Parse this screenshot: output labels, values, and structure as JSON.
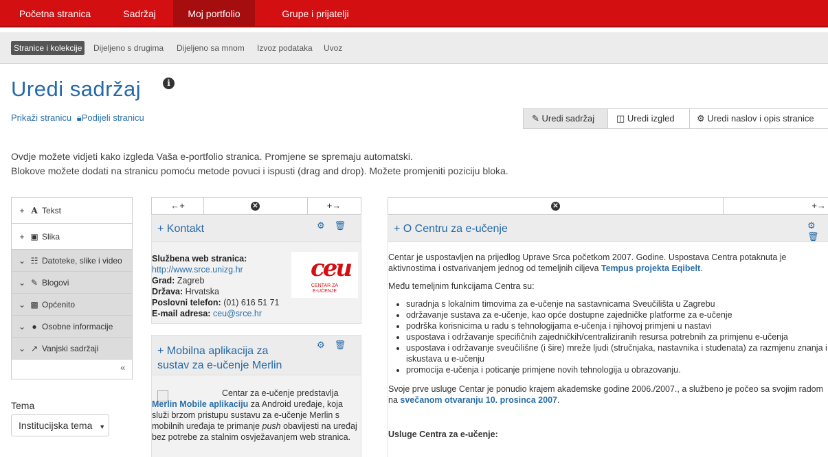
{
  "topnav": [
    "Početna stranica",
    "Sadržaj",
    "Moj portfolio",
    "Grupe i prijatelji"
  ],
  "subnav": [
    "Stranice i kolekcije",
    "Dijeljeno s drugima",
    "Dijeljeno sa mnom",
    "Izvoz podataka",
    "Uvoz"
  ],
  "page": {
    "title": "Uredi sadržaj",
    "info_icon": "i",
    "view_link": "Prikaži stranicu",
    "share_link": "Podijeli stranicu"
  },
  "edit_buttons": [
    "Uredi sadržaj",
    "Uredi izgled",
    "Uredi naslov i opis stranice"
  ],
  "intro": [
    "Ovdje možete vidjeti kako izgleda Vaša e-portfolio stranica. Promjene se spremaju automatski.",
    "Blokove možete dodati na stranicu pomoću metode povuci i ispusti (drag and drop). Možete promjeniti poziciju bloka."
  ],
  "sidebar": {
    "items": [
      {
        "label": "Tekst",
        "icon": "text-icon"
      },
      {
        "label": "Slika",
        "icon": "image-icon"
      },
      {
        "label": "Datoteke, slike i video",
        "icon": "film-icon"
      },
      {
        "label": "Blogovi",
        "icon": "pencil-icon"
      },
      {
        "label": "Općenito",
        "icon": "briefcase-icon"
      },
      {
        "label": "Osobne informacije",
        "icon": "user-icon"
      },
      {
        "label": "Vanjski sadržaji",
        "icon": "external-link-icon"
      }
    ],
    "collapse": "«"
  },
  "tema": {
    "label": "Tema",
    "value": "Institucijska tema"
  },
  "col_controls": {
    "left": "←+",
    "remove": "✕",
    "right": "+→"
  },
  "kontakt": {
    "title": "+ Kontakt",
    "lines": [
      {
        "k": "Službena web stranica:",
        "v": ""
      },
      {
        "k": "",
        "v": "http://www.srce.unizg.hr",
        "link": true
      },
      {
        "k": "Grad:",
        "v": "Zagreb"
      },
      {
        "k": "Država:",
        "v": "Hrvatska"
      },
      {
        "k": "Poslovni telefon:",
        "v": "(01) 616 51 71"
      },
      {
        "k": "E-mail adresa:",
        "v": "ceu@srce.hr",
        "link": true
      }
    ],
    "logo_text": "ceu",
    "logo_caption": [
      "CENTAR ZA",
      "E-UČENJE"
    ]
  },
  "merlin": {
    "title": [
      "+ Mobilna aplikacija za",
      "sustav za e-učenje Merlin"
    ],
    "text_a": "Centar za e-učenje predstavlja ",
    "link": "Merlin Mobile aplikaciju",
    "text_b": " za Android uređaje, koja služi brzom pristupu sustavu za e-učenje Merlin s mobilnih uređaja te primanje ",
    "italic": "push",
    "text_c": " obavijesti na uređaj bez potrebe za stalnim osvježavanjem web stranica."
  },
  "centar": {
    "title": "+ O Centru za e-učenje",
    "p1a": "Centar je uspostavljen na prijedlog Uprave Srca početkom 2007. Godine. Uspostava Centra potaknuta je aktivnostima i ostvarivanjem jednog od temeljnih ciljeva ",
    "p1link": "Tempus projekta Eqibelt",
    "p1b": ".",
    "p2": "Među temeljnim funkcijama Centra su:",
    "list": [
      "suradnja s lokalnim timovima za e-učenje na sastavnicama Sveučilišta u Zagrebu",
      "održavanje sustava za e-učenje, kao opće dostupne zajedničke platforme za e-učenje",
      "podrška korisnicima u radu s tehnologijama e-učenja i njihovoj primjeni u nastavi",
      "uspostava i održavanje specifičnih zajedničkih/centraliziranih resursa potrebnih za primjenu e-učenja",
      "uspostava i održavanje sveučilišne (i šire) mreže ljudi (stručnjaka, nastavnika i studenata) za razmjenu znanja i iskustava u e-učenju",
      "promocija e-učenja i poticanje primjene novih tehnologija u obrazovanju."
    ],
    "p3a": "Svoje prve usluge Centar je ponudio krajem akademske godine 2006./2007., a službeno je počeo sa svojim radom na ",
    "p3link": "svečanom otvaranju 10. prosinca 2007",
    "p3b": ".",
    "h4": "Usluge Centra za e-učenje:"
  },
  "colors": {
    "brand_red": "#d30f12",
    "link_blue": "#2a6ea6"
  }
}
